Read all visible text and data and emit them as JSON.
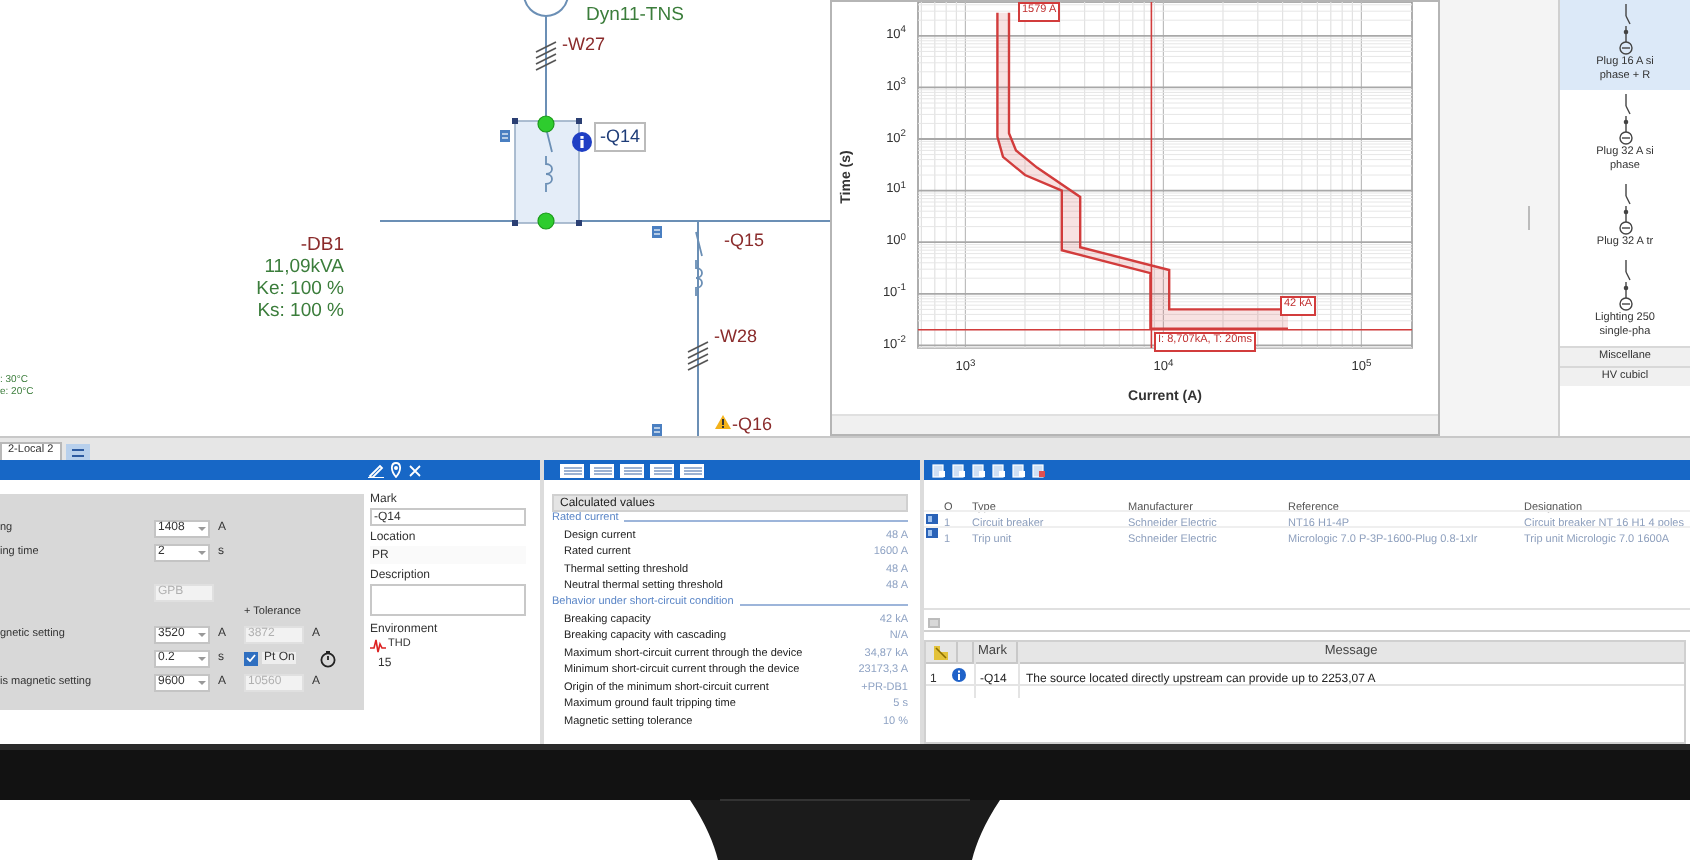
{
  "diagram": {
    "transformer_label": "Dyn11-TNS",
    "cables": [
      {
        "label": "-W27"
      },
      {
        "label": "-W28"
      }
    ],
    "devices": [
      {
        "label": "-Q14",
        "selected": true,
        "kind": "info"
      },
      {
        "label": "-Q15",
        "selected": false,
        "kind": "plain"
      },
      {
        "label": "-Q16",
        "selected": false,
        "kind": "warning"
      }
    ],
    "switchboard": {
      "label": "-DB1",
      "lines": [
        "11,09kVA",
        "Ke: 100 %",
        "Ks: 100 %"
      ]
    },
    "ambient_notes": [
      ": 30°C",
      "e: 20°C"
    ]
  },
  "curve_window": {
    "xlabel": "Current (A)",
    "ylabel": "Time (s)",
    "x_tick_labels": [
      "10$^{3}$",
      "10$^{4}$",
      "10$^{5}$"
    ],
    "y_tick_labels": [
      "10$^{4}$",
      "10$^{3}$",
      "10$^{2}$",
      "10$^{1}$",
      "10$^{0}$",
      "10$^{-1}$",
      "10$^{-2}$"
    ],
    "annotations": [
      "I: 8,707kA, T: 20ms",
      "42 kA",
      "1579 A"
    ]
  },
  "palette": {
    "items": [
      {
        "kind": "symbol",
        "label": "Plug 16 A si\nphase + R",
        "selected": true
      },
      {
        "kind": "symbol",
        "label": "Plug 32 A si\nphase",
        "selected": false
      },
      {
        "kind": "symbol",
        "label": "Plug 32 A tr",
        "selected": false
      },
      {
        "kind": "symbol",
        "label": "Lighting 250\nsingle-pha",
        "selected": false
      },
      {
        "kind": "group",
        "label": "Miscellane"
      },
      {
        "kind": "group",
        "label": "HV cubicl"
      }
    ]
  },
  "document_tabs": [
    {
      "label": "2-Local 2",
      "selected": true
    }
  ],
  "settings": [
    {
      "kind": "dropdown",
      "label": "ng",
      "value": "1408",
      "unit": "A"
    },
    {
      "kind": "dropdown",
      "label": "ing time",
      "value": "2",
      "unit": "s"
    },
    {
      "kind": "readonly",
      "value": "GPB",
      "disabled": true
    },
    {
      "kind": "header",
      "label": "+ Tolerance"
    },
    {
      "kind": "dropdown",
      "label": "gnetic setting",
      "value": "3520",
      "unit": "A",
      "tolerance": {
        "value": "3872",
        "unit": "A",
        "disabled": true
      }
    },
    {
      "kind": "dropdown",
      "value": "0.2",
      "unit": "s",
      "option": {
        "label": "Pt On",
        "checked": true
      }
    },
    {
      "kind": "dropdown",
      "label": "is magnetic setting",
      "value": "9600",
      "unit": "A",
      "tolerance": {
        "value": "10560",
        "unit": "A",
        "disabled": true
      }
    }
  ],
  "identification": {
    "mark_label": "Mark",
    "mark": "-Q14",
    "location_label": "Location",
    "location": "PR",
    "description_label": "Description",
    "environment_label": "Environment",
    "environment": {
      "label": "THD",
      "value": "15"
    }
  },
  "calculated": {
    "title": "Calculated values",
    "sections": [
      {
        "title": "Rated current",
        "rows": [
          {
            "label": "Design current",
            "value": "48 A"
          },
          {
            "label": "Rated current",
            "value": "1600 A"
          },
          {
            "label": "Thermal setting threshold",
            "value": "48 A"
          },
          {
            "label": "Neutral thermal setting threshold",
            "value": "48 A"
          }
        ]
      },
      {
        "title": "Behavior under short-circuit condition",
        "rows": [
          {
            "label": "Breaking capacity",
            "value": "42 kA"
          },
          {
            "label": "Breaking capacity with cascading",
            "value": "N/A"
          },
          {
            "label": "Maximum short-circuit current through the device",
            "value": "34,87 kA"
          },
          {
            "label": "Minimum short-circuit current through the device",
            "value": "23173,3 A"
          },
          {
            "label": "Origin of the minimum short-circuit current",
            "value": "+PR-DB1"
          },
          {
            "label": "Maximum ground fault tripping time",
            "value": "5 s"
          },
          {
            "label": "Magnetic setting tolerance",
            "value": "10 %"
          }
        ]
      }
    ]
  },
  "equipment": {
    "columns": [
      "Q",
      "Type",
      "Manufacturer",
      "Reference",
      "Designation"
    ],
    "rows": [
      {
        "cells": [
          "1",
          "Circuit breaker",
          "Schneider Electric",
          "NT16 H1-4P",
          "Circuit breaker NT 16 H1 4 poles"
        ]
      },
      {
        "cells": [
          "1",
          "Trip unit",
          "Schneider Electric",
          "Micrologic 7.0 P-3P-1600-Plug 0.8-1xIr",
          "Trip unit Micrologic 7.0 1600A"
        ]
      }
    ]
  },
  "messages": {
    "columns": [
      "Mark",
      "Message"
    ],
    "rows": [
      {
        "number": "1",
        "kind": "info",
        "mark": "-Q14",
        "message": "The source located directly upstream can provide up to 2253,07 A"
      }
    ]
  }
}
